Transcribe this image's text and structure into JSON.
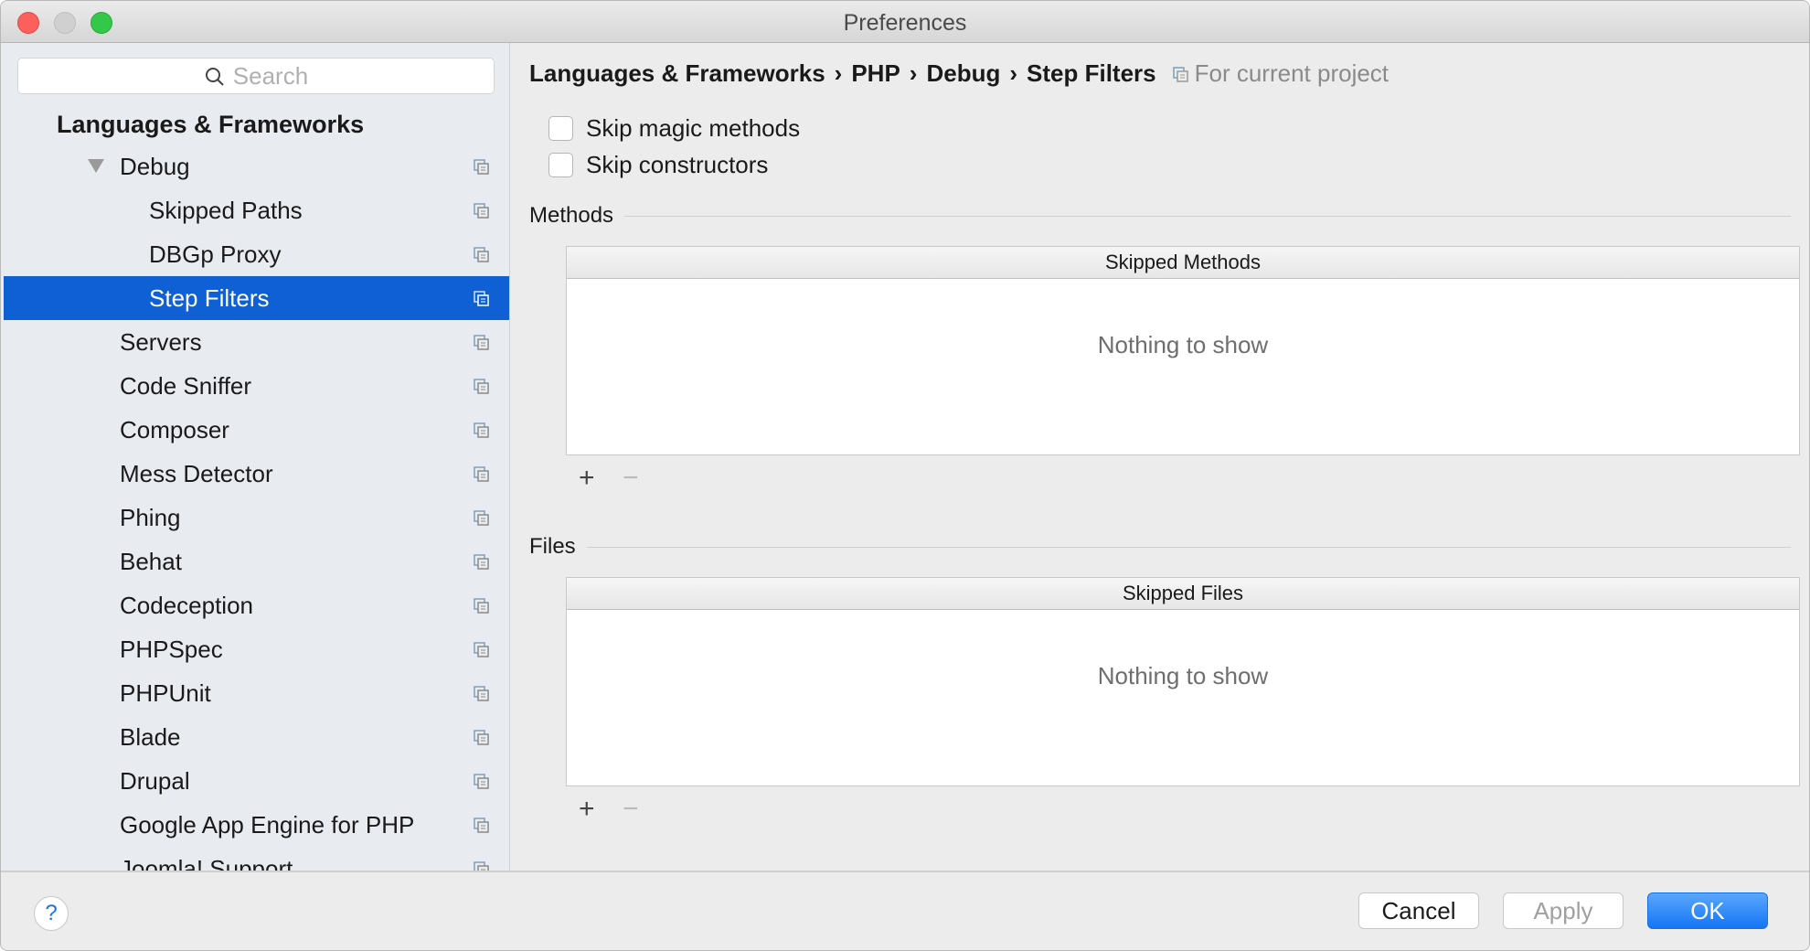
{
  "window": {
    "title": "Preferences"
  },
  "search": {
    "placeholder": "Search"
  },
  "sidebar": {
    "section": "Languages & Frameworks",
    "items": [
      {
        "label": "Debug",
        "level": 1,
        "expanded": true
      },
      {
        "label": "Skipped Paths",
        "level": 2
      },
      {
        "label": "DBGp Proxy",
        "level": 2
      },
      {
        "label": "Step Filters",
        "level": 2,
        "selected": true
      },
      {
        "label": "Servers",
        "level": 1
      },
      {
        "label": "Code Sniffer",
        "level": 1
      },
      {
        "label": "Composer",
        "level": 1
      },
      {
        "label": "Mess Detector",
        "level": 1
      },
      {
        "label": "Phing",
        "level": 1
      },
      {
        "label": "Behat",
        "level": 1
      },
      {
        "label": "Codeception",
        "level": 1
      },
      {
        "label": "PHPSpec",
        "level": 1
      },
      {
        "label": "PHPUnit",
        "level": 1
      },
      {
        "label": "Blade",
        "level": 1
      },
      {
        "label": "Drupal",
        "level": 1
      },
      {
        "label": "Google App Engine for PHP",
        "level": 1
      },
      {
        "label": "Joomla! Support",
        "level": 1
      }
    ]
  },
  "breadcrumb": {
    "items": [
      "Languages & Frameworks",
      "PHP",
      "Debug",
      "Step Filters"
    ],
    "separator": "›",
    "scope": "For current project"
  },
  "options": {
    "skip_magic": {
      "label": "Skip magic methods",
      "checked": false
    },
    "skip_constructors": {
      "label": "Skip constructors",
      "checked": false
    }
  },
  "methods": {
    "group": "Methods",
    "header": "Skipped Methods",
    "empty": "Nothing to show"
  },
  "files": {
    "group": "Files",
    "header": "Skipped Files",
    "empty": "Nothing to show"
  },
  "toolbar": {
    "add": "+",
    "remove": "−"
  },
  "footer": {
    "help": "?",
    "cancel": "Cancel",
    "apply": "Apply",
    "ok": "OK"
  },
  "colors": {
    "selection": "#0f5fd5",
    "ok": "#1a7cf5"
  }
}
